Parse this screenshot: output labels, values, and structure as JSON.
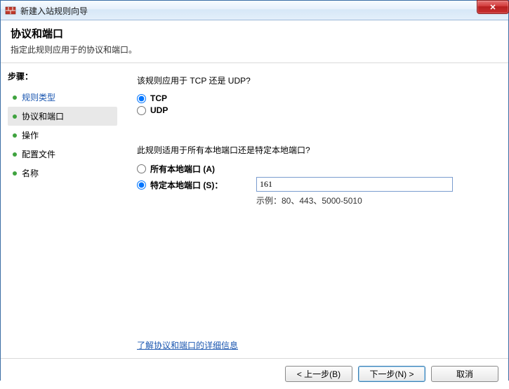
{
  "window": {
    "title": "新建入站规则向导",
    "close_label": "✕"
  },
  "header": {
    "title": "协议和端口",
    "subtitle": "指定此规则应用于的协议和端口。"
  },
  "sidebar": {
    "steps_title": "步骤：",
    "items": [
      {
        "label": "规则类型"
      },
      {
        "label": "协议和端口"
      },
      {
        "label": "操作"
      },
      {
        "label": "配置文件"
      },
      {
        "label": "名称"
      }
    ]
  },
  "main": {
    "protocol_question": "该规则应用于 TCP 还是 UDP?",
    "tcp_label": "TCP",
    "udp_label": "UDP",
    "port_question": "此规则适用于所有本地端口还是特定本地端口?",
    "all_ports_label": "所有本地端口 (A)",
    "specific_ports_label": "特定本地端口 (S)：",
    "port_value": "161",
    "port_example": "示例：80、443、5000-5010",
    "learn_more": "了解协议和端口的详细信息"
  },
  "footer": {
    "back": "< 上一步(B)",
    "next": "下一步(N) >",
    "cancel": "取消"
  }
}
